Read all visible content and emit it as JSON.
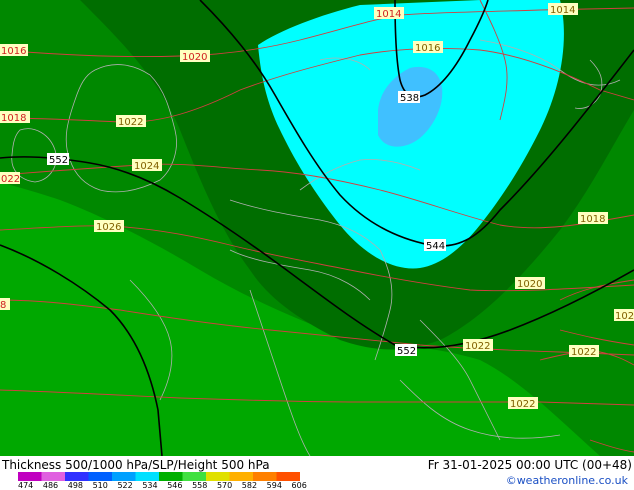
{
  "map": {
    "colors": {
      "thick_546": "#008f00",
      "thick_552_outer": "#00b000",
      "thick_534": "#00ffff",
      "thick_528": "#40c0ff",
      "thick_540": "#007000",
      "coast": "#b0b0b0",
      "slp": "#d04040",
      "height500": "#000000"
    },
    "height500_labels": [
      "538",
      "544",
      "552",
      "552"
    ],
    "slp_labels": [
      "1014",
      "1014",
      "1016",
      "1016",
      "1018",
      "1020",
      "1022",
      "1022",
      "1024",
      "1026",
      "1018",
      "1020",
      "1022",
      "1022",
      "1022",
      "1020",
      "1022",
      "1018"
    ]
  },
  "footer": {
    "title": "Thickness 500/1000 hPa/SLP/Height 500 hPa",
    "valid": "Fr 31-01-2025 00:00 UTC (00+48)",
    "credit": "©weatheronline.co.uk",
    "legend": {
      "ticks": [
        "474",
        "486",
        "498",
        "510",
        "522",
        "534",
        "546",
        "558",
        "570",
        "582",
        "594",
        "606"
      ],
      "colors": [
        "#c000c0",
        "#e060e0",
        "#3030ff",
        "#0060ff",
        "#00a0ff",
        "#00e0ff",
        "#00b000",
        "#40e040",
        "#e0e000",
        "#ffb000",
        "#ff8000",
        "#ff5000"
      ]
    }
  }
}
